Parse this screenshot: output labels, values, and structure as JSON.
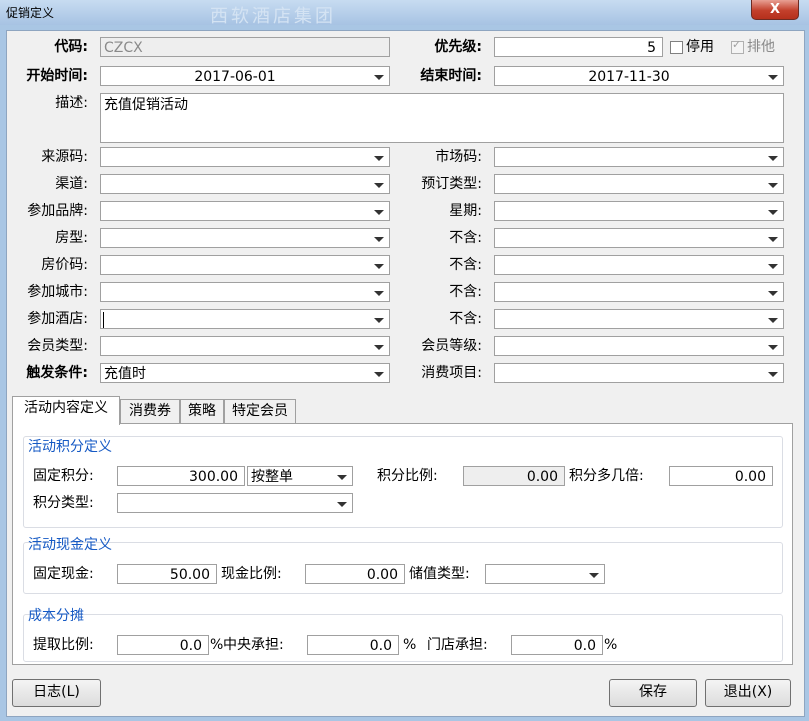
{
  "window": {
    "title": "促销定义",
    "watermark": "西软酒店集团",
    "close": "X"
  },
  "header": {
    "code_label": "代码:",
    "code_value": "CZCX",
    "priority_label": "优先级:",
    "priority_value": "5",
    "disable_label": "停用",
    "exclude_label": "排他",
    "start_label": "开始时间:",
    "start_value": "2017-06-01",
    "end_label": "结束时间:",
    "end_value": "2017-11-30",
    "desc_label": "描述:",
    "desc_value": "充值促销活动"
  },
  "fields_left": [
    {
      "label": "来源码:",
      "value": ""
    },
    {
      "label": "渠道:",
      "value": ""
    },
    {
      "label": "参加品牌:",
      "value": ""
    },
    {
      "label": "房型:",
      "value": ""
    },
    {
      "label": "房价码:",
      "value": ""
    },
    {
      "label": "参加城市:",
      "value": ""
    },
    {
      "label": "参加酒店:",
      "value": ""
    },
    {
      "label": "会员类型:",
      "value": ""
    },
    {
      "label": "触发条件:",
      "value": "充值时"
    }
  ],
  "fields_right": [
    {
      "label": "市场码:",
      "value": ""
    },
    {
      "label": "预订类型:",
      "value": ""
    },
    {
      "label": "星期:",
      "value": ""
    },
    {
      "label": "不含:",
      "value": ""
    },
    {
      "label": "不含:",
      "value": ""
    },
    {
      "label": "不含:",
      "value": ""
    },
    {
      "label": "不含:",
      "value": ""
    },
    {
      "label": "会员等级:",
      "value": ""
    },
    {
      "label": "消费项目:",
      "value": ""
    }
  ],
  "tabs": [
    "活动内容定义",
    "消费券",
    "策略",
    "特定会员"
  ],
  "points": {
    "title": "活动积分定义",
    "fixed_label": "固定积分:",
    "fixed_value": "300.00",
    "round_value": "按整单",
    "ratio_label": "积分比例:",
    "ratio_value": "0.00",
    "multiple_label": "积分多几倍:",
    "multiple_value": "0.00",
    "type_label": "积分类型:",
    "type_value": ""
  },
  "cash": {
    "title": "活动现金定义",
    "fixed_label": "固定现金:",
    "fixed_value": "50.00",
    "ratio_label": "现金比例:",
    "ratio_value": "0.00",
    "store_label": "储值类型:",
    "store_value": ""
  },
  "cost": {
    "title": "成本分摊",
    "extract_label": "提取比例:",
    "extract_value": "0.0",
    "central_label": "中央承担:",
    "central_value": "0.0",
    "store_label": "门店承担:",
    "store_value": "0.0",
    "pct": "%"
  },
  "buttons": {
    "log": "日志(L)",
    "save": "保存",
    "exit": "退出(X)"
  }
}
